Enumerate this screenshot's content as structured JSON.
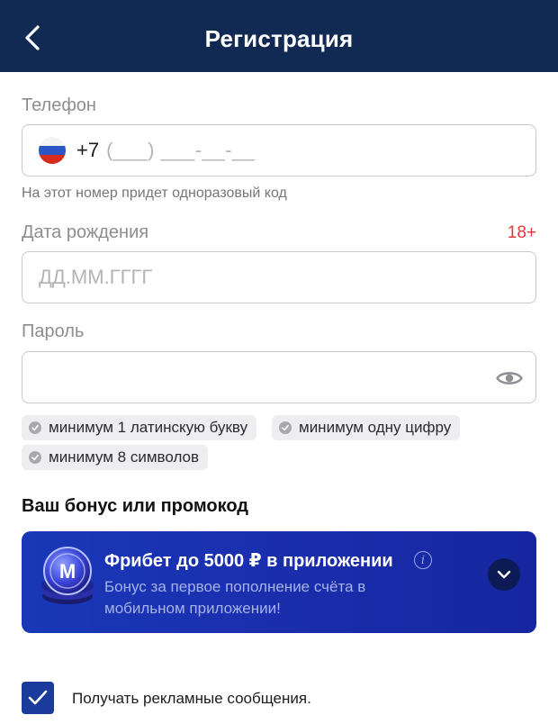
{
  "header": {
    "title": "Регистрация",
    "back_icon": "chevron-left-icon"
  },
  "phone": {
    "label": "Телефон",
    "country_flag": "russia-flag-icon",
    "code": "+7",
    "mask": "(___) ___-__-__",
    "hint": "На этот номер придет одноразовый код"
  },
  "birthdate": {
    "label": "Дата рождения",
    "age_badge": "18+",
    "placeholder": "ДД.ММ.ГГГГ",
    "value": ""
  },
  "password": {
    "label": "Пароль",
    "value": "",
    "eye_icon": "eye-icon",
    "requirements": [
      "минимум 1 латинскую букву",
      "минимум одну цифру",
      "минимум 8 символов"
    ]
  },
  "bonus": {
    "section_title": "Ваш бонус или промокод",
    "name": "Фрибет до 5000 ₽ в приложении",
    "description": "Бонус за первое пополнение счёта в мобильном приложении!",
    "coin_letter": "M"
  },
  "consent": {
    "label": "Получать рекламные сообщения.",
    "checked": true
  },
  "colors": {
    "header_bg": "#112a53",
    "accent_red": "#e0383e",
    "card_blue": "#1a2fae",
    "checkbox_blue": "#1a3a9c"
  }
}
